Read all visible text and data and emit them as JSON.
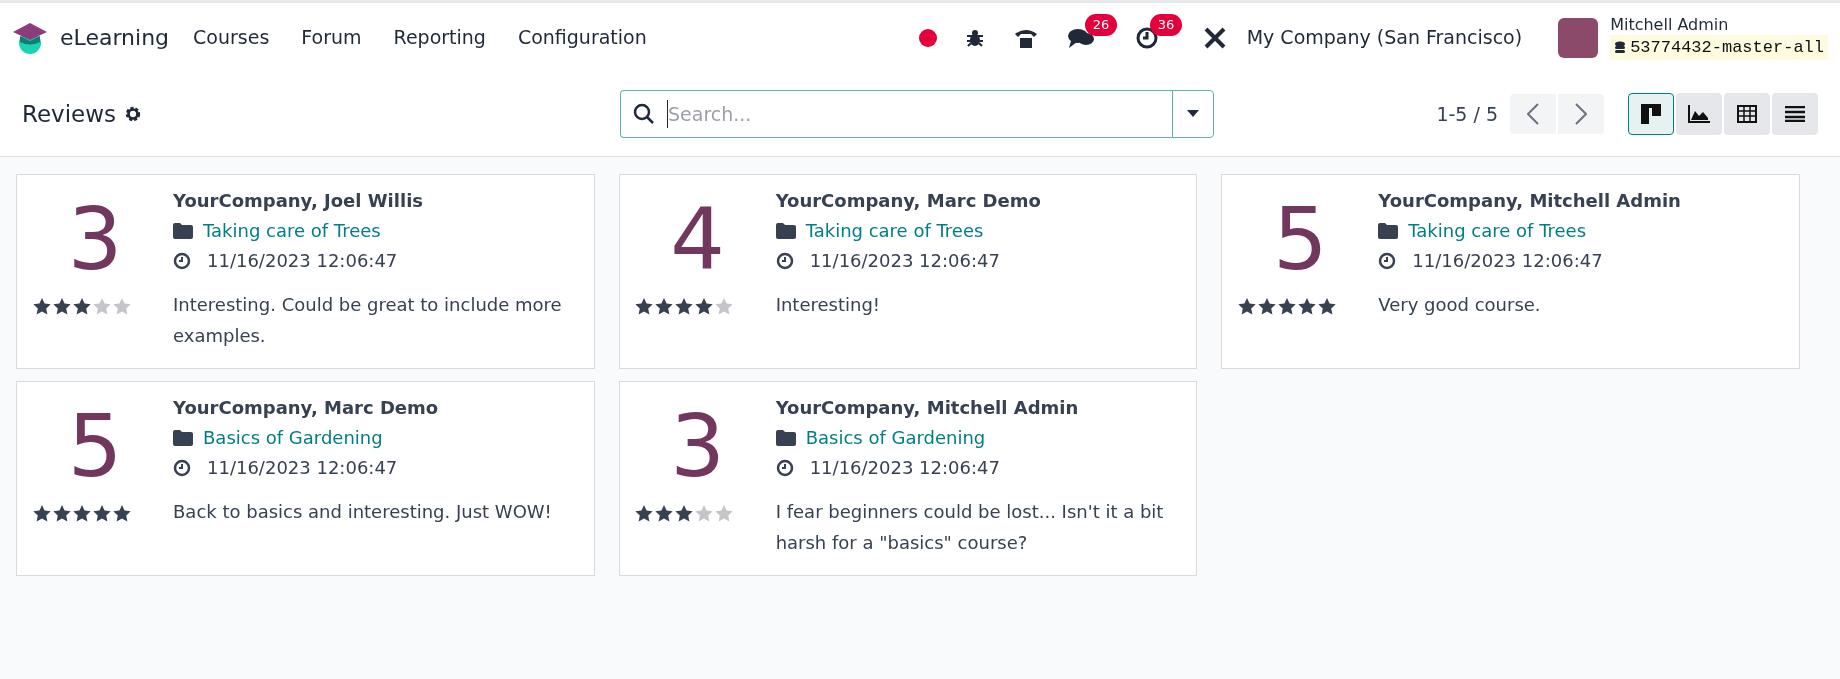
{
  "navbar": {
    "app_name": "eLearning",
    "menu": [
      "Courses",
      "Forum",
      "Reporting",
      "Configuration"
    ],
    "messages_count": "26",
    "activities_count": "36",
    "company": "My Company (San Francisco)",
    "user": "Mitchell Admin",
    "database": "53774432-master-all"
  },
  "control_panel": {
    "title": "Reviews",
    "search": {
      "placeholder": "Search..."
    },
    "pager": "1-5 / 5",
    "views": [
      {
        "kind": "kanban",
        "selected": true
      },
      {
        "kind": "graph",
        "selected": false
      },
      {
        "kind": "pivot",
        "selected": false
      },
      {
        "kind": "list",
        "selected": false
      }
    ]
  },
  "reviews": [
    {
      "score": "3",
      "stars": 3,
      "author": "YourCompany, Joel Willis",
      "course": "Taking care of Trees",
      "date": "11/16/2023 12:06:47",
      "comment": "Interesting. Could be great to include more examples."
    },
    {
      "score": "4",
      "stars": 4,
      "author": "YourCompany, Marc Demo",
      "course": "Taking care of Trees",
      "date": "11/16/2023 12:06:47",
      "comment": "Interesting!"
    },
    {
      "score": "5",
      "stars": 5,
      "author": "YourCompany, Mitchell Admin",
      "course": "Taking care of Trees",
      "date": "11/16/2023 12:06:47",
      "comment": "Very good course."
    },
    {
      "score": "5",
      "stars": 5,
      "author": "YourCompany, Marc Demo",
      "course": "Basics of Gardening",
      "date": "11/16/2023 12:06:47",
      "comment": "Back to basics and interesting. Just WOW!"
    },
    {
      "score": "3",
      "stars": 3,
      "author": "YourCompany, Mitchell Admin",
      "course": "Basics of Gardening",
      "date": "11/16/2023 12:06:47",
      "comment": "I fear beginners could be lost... Isn't it a bit harsh for a \"basics\" course?"
    }
  ]
}
